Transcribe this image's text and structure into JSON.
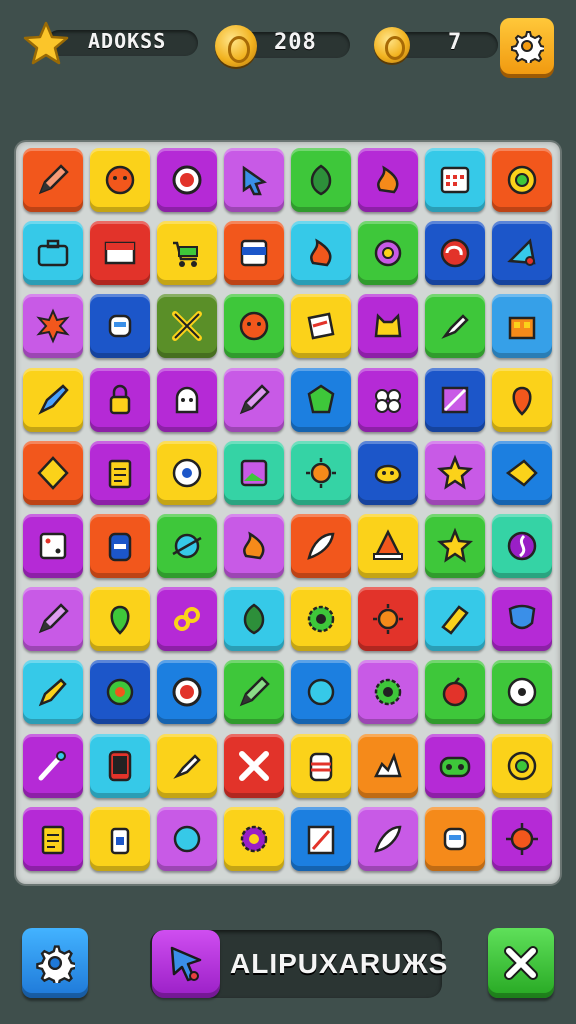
{
  "hud": {
    "player_name": "ADOKSS",
    "coins": "208",
    "level": "7",
    "star_icon": "star-icon",
    "coin_icon": "coin-icon",
    "settings_icon": "gear-icon"
  },
  "board": {
    "rows": 10,
    "cols": 8,
    "tiles": [
      {
        "color": "#f2571c",
        "icon": "pencil-icon"
      },
      {
        "color": "#fbd21a",
        "icon": "face-icon"
      },
      {
        "color": "#b52ad6",
        "icon": "ring-icon"
      },
      {
        "color": "#c85ae6",
        "icon": "arrow-icon"
      },
      {
        "color": "#3ec73a",
        "icon": "leaf-icon"
      },
      {
        "color": "#b52ad6",
        "icon": "flame-icon"
      },
      {
        "color": "#36c9e8",
        "icon": "calendar-icon"
      },
      {
        "color": "#f2571c",
        "icon": "target-icon"
      },
      {
        "color": "#36c9e8",
        "icon": "briefcase-icon"
      },
      {
        "color": "#e2332a",
        "icon": "flag-icon"
      },
      {
        "color": "#fbd21a",
        "icon": "cart-icon"
      },
      {
        "color": "#f2571c",
        "icon": "banner-icon"
      },
      {
        "color": "#36c9e8",
        "icon": "fire-icon"
      },
      {
        "color": "#3ec73a",
        "icon": "flower-icon"
      },
      {
        "color": "#1c56c9",
        "icon": "swirl-icon"
      },
      {
        "color": "#1c56c9",
        "icon": "card-icon"
      },
      {
        "color": "#c85ae6",
        "icon": "burst-icon"
      },
      {
        "color": "#1c56c9",
        "icon": "robot-icon"
      },
      {
        "color": "#5a8f28",
        "icon": "tools-icon"
      },
      {
        "color": "#3ec73a",
        "icon": "ball-icon"
      },
      {
        "color": "#fbd21a",
        "icon": "note-icon"
      },
      {
        "color": "#b52ad6",
        "icon": "cat-icon"
      },
      {
        "color": "#3ec73a",
        "icon": "brush-icon"
      },
      {
        "color": "#36a0e8",
        "icon": "house-icon"
      },
      {
        "color": "#fbd21a",
        "icon": "pen-icon"
      },
      {
        "color": "#b52ad6",
        "icon": "lock-icon"
      },
      {
        "color": "#b52ad6",
        "icon": "ghost-icon"
      },
      {
        "color": "#c85ae6",
        "icon": "pencil-icon"
      },
      {
        "color": "#1c7fe0",
        "icon": "tag-icon"
      },
      {
        "color": "#b52ad6",
        "icon": "clover-icon"
      },
      {
        "color": "#1c56c9",
        "icon": "frame-icon"
      },
      {
        "color": "#fbd21a",
        "icon": "map-pin-icon"
      },
      {
        "color": "#f2571c",
        "icon": "diamond-icon"
      },
      {
        "color": "#b52ad6",
        "icon": "clipboard-icon"
      },
      {
        "color": "#fbd21a",
        "icon": "eye-icon"
      },
      {
        "color": "#35d3a5",
        "icon": "picture-icon"
      },
      {
        "color": "#35d3a5",
        "icon": "sun-icon"
      },
      {
        "color": "#1c56c9",
        "icon": "blob-icon"
      },
      {
        "color": "#c85ae6",
        "icon": "star-icon"
      },
      {
        "color": "#1c7fe0",
        "icon": "kite-icon"
      },
      {
        "color": "#b52ad6",
        "icon": "dice-icon"
      },
      {
        "color": "#f2571c",
        "icon": "jar-icon"
      },
      {
        "color": "#3ec73a",
        "icon": "planet-icon"
      },
      {
        "color": "#c85ae6",
        "icon": "flame-icon"
      },
      {
        "color": "#f2571c",
        "icon": "feather-icon"
      },
      {
        "color": "#fbd21a",
        "icon": "cone-icon"
      },
      {
        "color": "#3ec73a",
        "icon": "star-icon"
      },
      {
        "color": "#35d3a5",
        "icon": "moon-icon"
      },
      {
        "color": "#c85ae6",
        "icon": "pencil-icon"
      },
      {
        "color": "#fbd21a",
        "icon": "pin-icon"
      },
      {
        "color": "#b52ad6",
        "icon": "link-icon"
      },
      {
        "color": "#36c9e8",
        "icon": "leaf-icon"
      },
      {
        "color": "#fbd21a",
        "icon": "gear-icon"
      },
      {
        "color": "#e2332a",
        "icon": "sun-icon"
      },
      {
        "color": "#36c9e8",
        "icon": "eraser-icon"
      },
      {
        "color": "#b52ad6",
        "icon": "shield-icon"
      },
      {
        "color": "#36c9e8",
        "icon": "rocket-icon"
      },
      {
        "color": "#1c56c9",
        "icon": "bug-icon"
      },
      {
        "color": "#1c7fe0",
        "icon": "ring-icon"
      },
      {
        "color": "#3ec73a",
        "icon": "pencil-icon"
      },
      {
        "color": "#1c7fe0",
        "icon": "orb-icon"
      },
      {
        "color": "#c85ae6",
        "icon": "gear-icon"
      },
      {
        "color": "#3ec73a",
        "icon": "apple-icon"
      },
      {
        "color": "#3ec73a",
        "icon": "disc-icon"
      },
      {
        "color": "#b52ad6",
        "icon": "wand-icon"
      },
      {
        "color": "#36c9e8",
        "icon": "phone-icon"
      },
      {
        "color": "#fbd21a",
        "icon": "brush-icon"
      },
      {
        "color": "#e2332a",
        "icon": "cross-icon"
      },
      {
        "color": "#fbd21a",
        "icon": "can-icon"
      },
      {
        "color": "#f58a1a",
        "icon": "splash-icon"
      },
      {
        "color": "#b52ad6",
        "icon": "gamepad-icon"
      },
      {
        "color": "#fbd21a",
        "icon": "target-icon"
      },
      {
        "color": "#b52ad6",
        "icon": "clipboard-icon"
      },
      {
        "color": "#fbd21a",
        "icon": "bottle-icon"
      },
      {
        "color": "#c85ae6",
        "icon": "chat-icon"
      },
      {
        "color": "#fbd21a",
        "icon": "cog-icon"
      },
      {
        "color": "#1c7fe0",
        "icon": "book-icon"
      },
      {
        "color": "#c85ae6",
        "icon": "quill-icon"
      },
      {
        "color": "#f58a1a",
        "icon": "robot-icon"
      },
      {
        "color": "#b52ad6",
        "icon": "virus-icon"
      }
    ]
  },
  "footer": {
    "left_button_icon": "gear-icon",
    "hint_icon": "cursor-icon",
    "hint_text": "ALIPUXARUЖS",
    "close_icon": "close-icon",
    "left_button_color": "#1e90e8",
    "close_button_color": "#3ec73a"
  }
}
